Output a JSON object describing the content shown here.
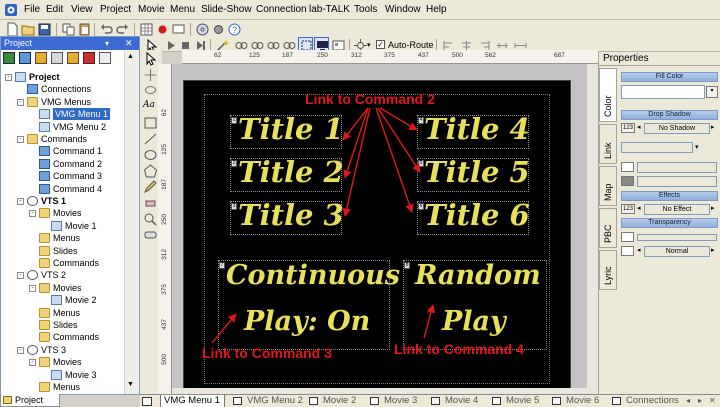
{
  "menubar": {
    "items": [
      "File",
      "Edit",
      "View",
      "Project",
      "Movie",
      "Menu",
      "Slide-Show",
      "Connection",
      "lab-TALK",
      "Tools",
      "Window",
      "Help"
    ]
  },
  "toolbar": {
    "auto_route_label": "Auto-Route",
    "auto_route_checked": true
  },
  "project_panel": {
    "title": "Project",
    "tree": [
      {
        "label": "Project",
        "level": 0,
        "icon": "project-icon",
        "bold": true,
        "expander": "-"
      },
      {
        "label": "Connections",
        "level": 1,
        "icon": "connections-icon"
      },
      {
        "label": "VMG Menus",
        "level": 1,
        "icon": "folder-icon",
        "expander": "-"
      },
      {
        "label": "VMG Menu 1",
        "level": 2,
        "icon": "menu-icon",
        "selected": true
      },
      {
        "label": "VMG Menu 2",
        "level": 2,
        "icon": "menu-icon"
      },
      {
        "label": "Commands",
        "level": 1,
        "icon": "folder-icon",
        "expander": "-"
      },
      {
        "label": "Command 1",
        "level": 2,
        "icon": "command-icon"
      },
      {
        "label": "Command 2",
        "level": 2,
        "icon": "command-icon"
      },
      {
        "label": "Command 3",
        "level": 2,
        "icon": "command-icon"
      },
      {
        "label": "Command 4",
        "level": 2,
        "icon": "command-icon"
      },
      {
        "label": "VTS 1",
        "level": 1,
        "icon": "vts-icon",
        "bold": true,
        "expander": "-"
      },
      {
        "label": "Movies",
        "level": 2,
        "icon": "folder-icon",
        "expander": "-"
      },
      {
        "label": "Movie 1",
        "level": 3,
        "icon": "movie-icon"
      },
      {
        "label": "Menus",
        "level": 2,
        "icon": "folder-icon"
      },
      {
        "label": "Slides",
        "level": 2,
        "icon": "folder-icon"
      },
      {
        "label": "Commands",
        "level": 2,
        "icon": "folder-icon"
      },
      {
        "label": "VTS 2",
        "level": 1,
        "icon": "vts-icon",
        "expander": "-"
      },
      {
        "label": "Movies",
        "level": 2,
        "icon": "folder-icon",
        "expander": "-"
      },
      {
        "label": "Movie 2",
        "level": 3,
        "icon": "movie-icon"
      },
      {
        "label": "Menus",
        "level": 2,
        "icon": "folder-icon"
      },
      {
        "label": "Slides",
        "level": 2,
        "icon": "folder-icon"
      },
      {
        "label": "Commands",
        "level": 2,
        "icon": "folder-icon"
      },
      {
        "label": "VTS 3",
        "level": 1,
        "icon": "vts-icon",
        "expander": "-"
      },
      {
        "label": "Movies",
        "level": 2,
        "icon": "folder-icon",
        "expander": "-"
      },
      {
        "label": "Movie 3",
        "level": 3,
        "icon": "movie-icon"
      },
      {
        "label": "Menus",
        "level": 2,
        "icon": "folder-icon"
      }
    ],
    "tab_label": "Project"
  },
  "rulers": {
    "top": [
      "62",
      "125",
      "187",
      "250",
      "312",
      "375",
      "437",
      "500",
      "562",
      "687"
    ],
    "left": [
      "62",
      "125",
      "187",
      "250",
      "312",
      "375",
      "437",
      "500"
    ]
  },
  "canvas": {
    "buttons": [
      {
        "text": "Title 1",
        "num": "1"
      },
      {
        "text": "Title 2",
        "num": "2"
      },
      {
        "text": "Title 3",
        "num": "3"
      },
      {
        "text": "Title 4",
        "num": "4"
      },
      {
        "text": "Title 5",
        "num": "5"
      },
      {
        "text": "Title 6",
        "num": "6"
      },
      {
        "text": "Continuous",
        "num": "7"
      },
      {
        "text": "Play: On",
        "num": ""
      },
      {
        "text": "Random",
        "num": "8"
      },
      {
        "text": "Play",
        "num": ""
      }
    ],
    "annotations": {
      "link2": "Link to Command 2",
      "link3": "Link to Command 3",
      "link4": "Link to Command 4"
    },
    "annotation_color": "#e01818",
    "title_color": "#e8e05a"
  },
  "properties": {
    "title": "Properties",
    "vtabs": [
      "Color",
      "Link",
      "Map",
      "PBC",
      "Lyric"
    ],
    "sections": {
      "fill_color": "Fill Color",
      "drop_shadow": "Drop Shadow",
      "effects": "Effects",
      "transparency": "Transparency"
    },
    "drop_shadow_value": "No Shadow",
    "drop_shadow_num": "123",
    "effects_value": "No Effect",
    "effects_num": "123",
    "transparency_mode": "Normal"
  },
  "bottom_tabs": [
    "VMG Menu 1",
    "VMG Menu 2",
    "Movie 2",
    "Movie 3",
    "Movie 4",
    "Movie 5",
    "Movie 6",
    "Connections"
  ]
}
